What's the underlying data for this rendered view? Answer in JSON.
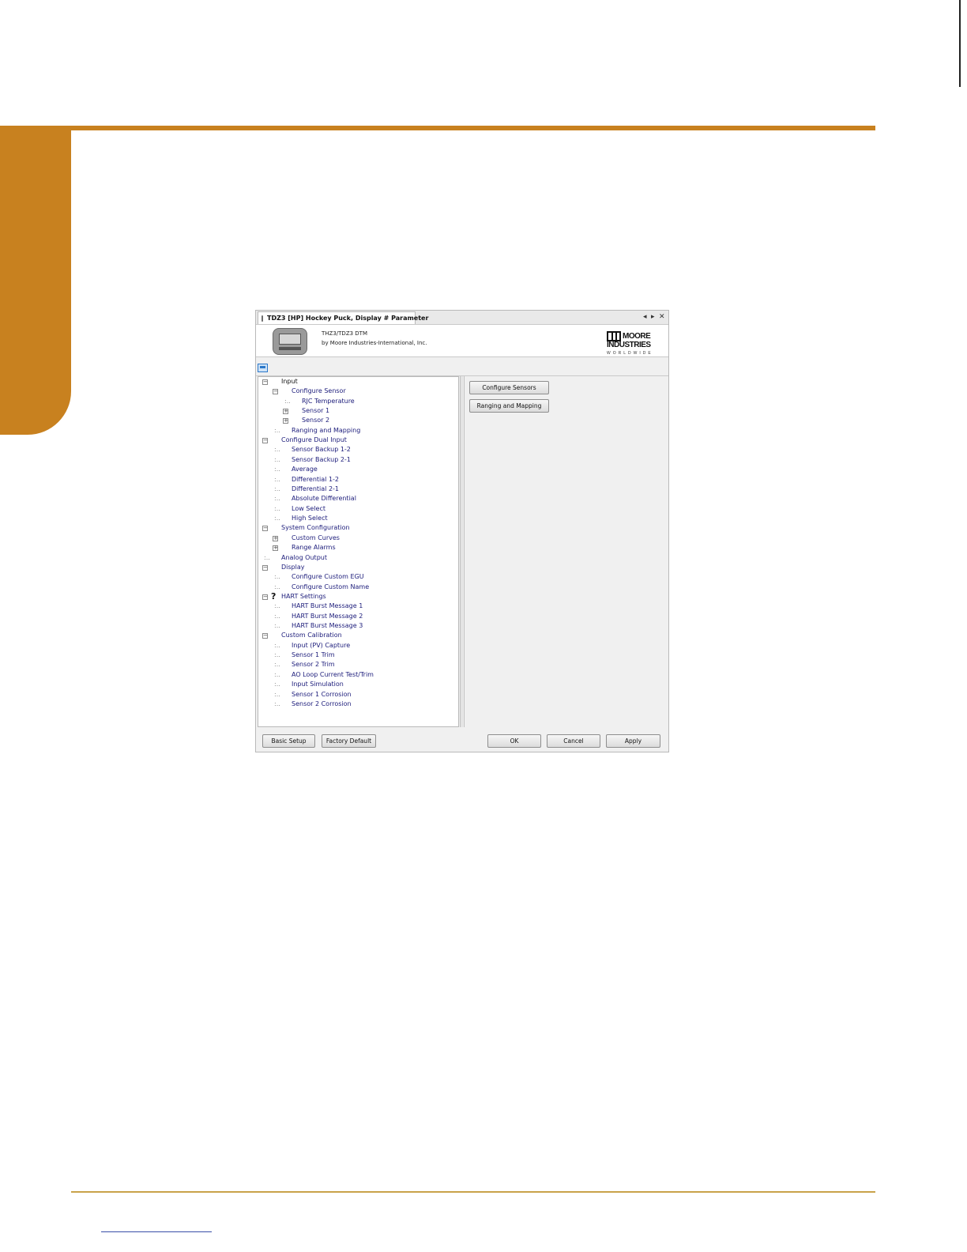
{
  "window": {
    "tab_title": "TDZ3 [HP] Hockey Puck, Display # Parameter",
    "tab_controls": {
      "prev": "◂",
      "next": "▸",
      "close": "✕"
    }
  },
  "header": {
    "dtm_name": "THZ3/TDZ3 DTM",
    "vendor": "by Moore Industries-International, Inc.",
    "logo": {
      "line1": "MOORE",
      "line2": "INDUSTRIES",
      "line3": "WORLDWIDE"
    }
  },
  "tree": {
    "input": "Input",
    "configure_sensor": "Configure Sensor",
    "rjc_temperature": "RJC Temperature",
    "sensor_1": "Sensor 1",
    "sensor_2": "Sensor 2",
    "ranging_and_mapping": "Ranging and Mapping",
    "configure_dual_input": "Configure Dual Input",
    "sensor_backup_1_2": "Sensor Backup 1-2",
    "sensor_backup_2_1": "Sensor Backup 2-1",
    "average": "Average",
    "differential_1_2": "Differential 1-2",
    "differential_2_1": "Differential 2-1",
    "absolute_differential": "Absolute Differential",
    "low_select": "Low Select",
    "high_select": "High Select",
    "system_configuration": "System Configuration",
    "custom_curves": "Custom Curves",
    "range_alarms": "Range Alarms",
    "analog_output": "Analog Output",
    "display": "Display",
    "configure_custom_egu": "Configure Custom EGU",
    "configure_custom_name": "Configure Custom Name",
    "hart_settings": "HART Settings",
    "hart_burst_1": "HART Burst Message 1",
    "hart_burst_2": "HART Burst Message 2",
    "hart_burst_3": "HART Burst Message 3",
    "custom_calibration": "Custom Calibration",
    "input_pv_capture": "Input (PV) Capture",
    "sensor_1_trim": "Sensor 1 Trim",
    "sensor_2_trim": "Sensor 2 Trim",
    "ao_loop_current": "AO Loop Current Test/Trim",
    "input_simulation": "Input Simulation",
    "sensor_1_corrosion": "Sensor 1 Corrosion",
    "sensor_2_corrosion": "Sensor 2 Corrosion"
  },
  "right_pane": {
    "configure_sensors": "Configure Sensors",
    "ranging_and_mapping": "Ranging and Mapping"
  },
  "footer": {
    "basic_setup": "Basic Setup",
    "factory_default": "Factory Default",
    "ok": "OK",
    "cancel": "Cancel",
    "apply": "Apply"
  },
  "colors": {
    "accent": "#c8811f",
    "tree_text": "#1b1b7a"
  }
}
